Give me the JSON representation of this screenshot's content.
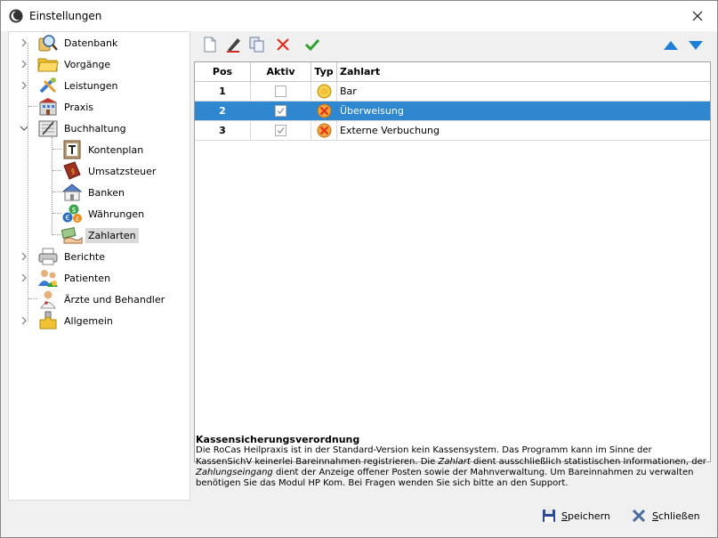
{
  "window": {
    "title": "Einstellungen"
  },
  "tree": {
    "items": [
      {
        "label": "Datenbank",
        "icon": "database-search-icon"
      },
      {
        "label": "Vorgänge",
        "icon": "folder-icon"
      },
      {
        "label": "Leistungen",
        "icon": "tools-icon"
      },
      {
        "label": "Praxis",
        "icon": "building-icon"
      },
      {
        "label": "Buchhaltung",
        "icon": "ledger-icon"
      },
      {
        "label": "Kontenplan",
        "icon": "account-chart-icon"
      },
      {
        "label": "Umsatzsteuer",
        "icon": "tax-book-icon"
      },
      {
        "label": "Banken",
        "icon": "bank-house-icon"
      },
      {
        "label": "Währungen",
        "icon": "currency-icon"
      },
      {
        "label": "Zahlarten",
        "icon": "payment-hand-icon"
      },
      {
        "label": "Berichte",
        "icon": "printer-icon"
      },
      {
        "label": "Patienten",
        "icon": "patients-icon"
      },
      {
        "label": "Ärzte und Behandler",
        "icon": "doctor-icon"
      },
      {
        "label": "Allgemein",
        "icon": "puzzle-icon"
      }
    ]
  },
  "grid": {
    "headers": {
      "pos": "Pos",
      "aktiv": "Aktiv",
      "typ": "Typ",
      "zahlart": "Zahlart"
    },
    "rows": [
      {
        "pos": "1",
        "aktiv": false,
        "typ": "coin-icon",
        "zahlart": "Bar"
      },
      {
        "pos": "2",
        "aktiv": true,
        "typ": "transfer-icon",
        "zahlart": "Überweisung"
      },
      {
        "pos": "3",
        "aktiv": true,
        "typ": "transfer-icon",
        "zahlart": "Externe Verbuchung"
      }
    ]
  },
  "info": {
    "title": "Kassensicherungsverordnung",
    "text_1": "Die RoCas Heilpraxis ist in der Standard-Version kein Kassensystem. Das Programm kann im Sinne der KassenSichV keinerlei Bareinnahmen registrieren. Die ",
    "em_1": "Zahlart",
    "text_2": " dient ausschließlich statistischen Informationen, der ",
    "em_2": "Zahlungseingang",
    "text_3": " dient der Anzeige  offener Posten sowie der Mahnverwaltung. Um Bareinnahmen zu verwalten benötigen Sie das Modul HP Kom. Bei Fragen wenden Sie sich bitte an den Support."
  },
  "buttons": {
    "save": "Speichern",
    "close": "Schließen"
  },
  "colors": {
    "selection": "#2f87d0",
    "accent_arrow": "#1f7fd6",
    "delete": "#e0301e",
    "confirm": "#2ea02e"
  }
}
